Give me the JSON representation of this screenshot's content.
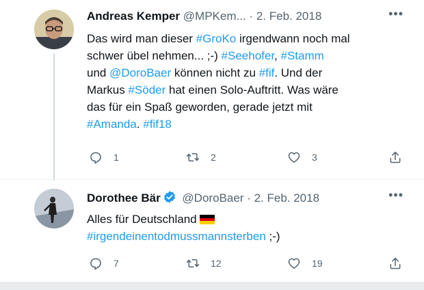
{
  "tweets": [
    {
      "name": "Andreas Kemper",
      "handle": "@MPKem...",
      "separator": "·",
      "date": "2. Feb. 2018",
      "more_label": "•••",
      "text": {
        "l1a": "Das wird man dieser ",
        "l1b": "#GroKo",
        "l1c": " irgendwann noch mal",
        "l2a": "schwer übel nehmen... ;-) ",
        "l2b": "#Seehofer",
        "l2c": ", ",
        "l2d": "#Stamm",
        "l3a": "und ",
        "l3b": "@DoroBaer",
        "l3c": " können nicht zu ",
        "l3d": "#fif",
        "l3e": ". Und der",
        "l4a": "Markus ",
        "l4b": "#Söder",
        "l4c": " hat einen Solo-Auftritt. Was wäre",
        "l5a": "das für ein Spaß geworden, gerade jetzt mit",
        "l6a": "#Amanda",
        "l6b": ". ",
        "l6c": "#fif18"
      },
      "actions": {
        "replies": "1",
        "retweets": "2",
        "likes": "3"
      }
    },
    {
      "name": "Dorothee Bär",
      "handle": "@DoroBaer",
      "separator": "·",
      "date": "2. Feb. 2018",
      "more_label": "•••",
      "text": {
        "l1a": "Alles für Deutschland",
        "l2a": "#irgendeinentodmussmannsterben",
        "l2b": " ;-)"
      },
      "actions": {
        "replies": "7",
        "retweets": "12",
        "likes": "19"
      }
    }
  ],
  "colors": {
    "link": "#1d9bf0",
    "text": "#0f1419",
    "muted": "#536471",
    "verified": "#1d9bf0"
  },
  "icons": [
    "reply-icon",
    "retweet-icon",
    "like-icon",
    "share-icon",
    "verified-icon",
    "flag-germany-icon",
    "more-icon"
  ]
}
